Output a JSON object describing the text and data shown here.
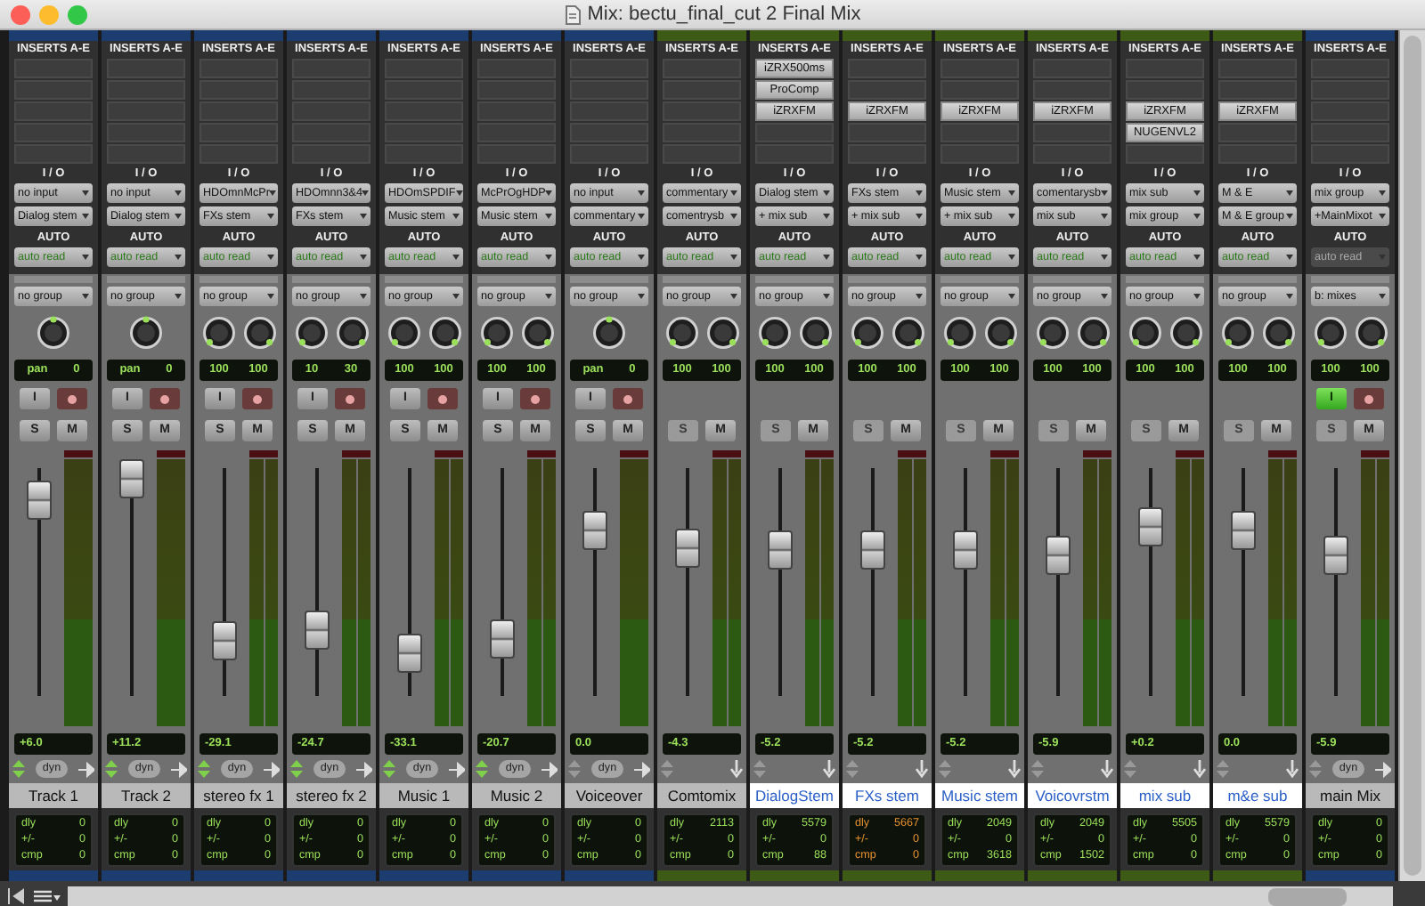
{
  "window": {
    "title": "Mix: bectu_final_cut 2  Final Mix"
  },
  "strips": [
    {
      "name": "Track 1",
      "selected": false,
      "kind": "audio",
      "stereo": false,
      "color": "#1d3d70",
      "inserts": [
        {
          "kind": "empty"
        },
        {
          "kind": "empty"
        },
        {
          "kind": "empty"
        },
        {
          "kind": "empty"
        },
        {
          "kind": "empty"
        }
      ],
      "labels": [
        "INSERTS A-E",
        "I / O",
        "AUTO"
      ],
      "input": "no input",
      "output": "Dialog stem",
      "auto": "auto read",
      "auto_disabled": false,
      "group": "no group",
      "pan": [
        "pan",
        "0"
      ],
      "input_button": {
        "label": "I",
        "on": false
      },
      "solo": {
        "label": "S",
        "disabled": false
      },
      "mute": "M",
      "level": 0.86,
      "volume": "+6.0",
      "arrows_lit": true,
      "dyn": "dyn",
      "delay": [
        {
          "label": "dly",
          "value": "0"
        },
        {
          "label": "+/-",
          "value": "0"
        },
        {
          "label": "cmp",
          "value": "0"
        }
      ],
      "delay_warning": false
    },
    {
      "name": "Track 2",
      "selected": false,
      "kind": "audio",
      "stereo": false,
      "color": "#1d3d70",
      "inserts": [
        {
          "kind": "empty"
        },
        {
          "kind": "empty"
        },
        {
          "kind": "empty"
        },
        {
          "kind": "empty"
        },
        {
          "kind": "empty"
        }
      ],
      "labels": [
        "INSERTS A-E",
        "I / O",
        "AUTO"
      ],
      "input": "no input",
      "output": "Dialog stem",
      "auto": "auto read",
      "auto_disabled": false,
      "group": "no group",
      "pan": [
        "pan",
        "0"
      ],
      "input_button": {
        "label": "I",
        "on": false
      },
      "solo": {
        "label": "S",
        "disabled": false
      },
      "mute": "M",
      "level": 0.95,
      "volume": "+11.2",
      "arrows_lit": true,
      "dyn": "dyn",
      "delay": [
        {
          "label": "dly",
          "value": "0"
        },
        {
          "label": "+/-",
          "value": "0"
        },
        {
          "label": "cmp",
          "value": "0"
        }
      ],
      "delay_warning": false
    },
    {
      "name": "stereo fx 1",
      "selected": false,
      "kind": "audio",
      "stereo": true,
      "color": "#1d3d70",
      "inserts": [
        {
          "kind": "empty"
        },
        {
          "kind": "empty"
        },
        {
          "kind": "empty"
        },
        {
          "kind": "empty"
        },
        {
          "kind": "empty"
        }
      ],
      "labels": [
        "INSERTS A-E",
        "I / O",
        "AUTO"
      ],
      "input": "HDOmnMcPr",
      "output": "FXs stem",
      "auto": "auto read",
      "auto_disabled": false,
      "group": "no group",
      "pan": [
        "100",
        "100"
      ],
      "input_button": {
        "label": "I",
        "on": false
      },
      "solo": {
        "label": "S",
        "disabled": false
      },
      "mute": "M",
      "level": 0.24,
      "volume": "-29.1",
      "arrows_lit": true,
      "dyn": "dyn",
      "delay": [
        {
          "label": "dly",
          "value": "0"
        },
        {
          "label": "+/-",
          "value": "0"
        },
        {
          "label": "cmp",
          "value": "0"
        }
      ],
      "delay_warning": false
    },
    {
      "name": "stereo fx 2",
      "selected": false,
      "kind": "audio",
      "stereo": true,
      "color": "#1d3d70",
      "inserts": [
        {
          "kind": "empty"
        },
        {
          "kind": "empty"
        },
        {
          "kind": "empty"
        },
        {
          "kind": "empty"
        },
        {
          "kind": "empty"
        }
      ],
      "labels": [
        "INSERTS A-E",
        "I / O",
        "AUTO"
      ],
      "input": "HDOmnn3&4",
      "output": "FXs stem",
      "auto": "auto read",
      "auto_disabled": false,
      "group": "no group",
      "pan": [
        "10",
        "30"
      ],
      "input_button": {
        "label": "I",
        "on": false
      },
      "solo": {
        "label": "S",
        "disabled": false
      },
      "mute": "M",
      "level": 0.29,
      "volume": "-24.7",
      "arrows_lit": true,
      "dyn": "dyn",
      "delay": [
        {
          "label": "dly",
          "value": "0"
        },
        {
          "label": "+/-",
          "value": "0"
        },
        {
          "label": "cmp",
          "value": "0"
        }
      ],
      "delay_warning": false
    },
    {
      "name": "Music 1",
      "selected": false,
      "kind": "audio",
      "stereo": true,
      "color": "#1d3d70",
      "inserts": [
        {
          "kind": "empty"
        },
        {
          "kind": "empty"
        },
        {
          "kind": "empty"
        },
        {
          "kind": "empty"
        },
        {
          "kind": "empty"
        }
      ],
      "labels": [
        "INSERTS A-E",
        "I / O",
        "AUTO"
      ],
      "input": "HDOmSPDIF",
      "output": "Music stem",
      "auto": "auto read",
      "auto_disabled": false,
      "group": "no group",
      "pan": [
        "100",
        "100"
      ],
      "input_button": {
        "label": "I",
        "on": false
      },
      "solo": {
        "label": "S",
        "disabled": false
      },
      "mute": "M",
      "level": 0.19,
      "volume": "-33.1",
      "arrows_lit": true,
      "dyn": "dyn",
      "delay": [
        {
          "label": "dly",
          "value": "0"
        },
        {
          "label": "+/-",
          "value": "0"
        },
        {
          "label": "cmp",
          "value": "0"
        }
      ],
      "delay_warning": false
    },
    {
      "name": "Music 2",
      "selected": false,
      "kind": "audio",
      "stereo": true,
      "color": "#1d3d70",
      "inserts": [
        {
          "kind": "empty"
        },
        {
          "kind": "empty"
        },
        {
          "kind": "empty"
        },
        {
          "kind": "empty"
        },
        {
          "kind": "empty"
        }
      ],
      "labels": [
        "INSERTS A-E",
        "I / O",
        "AUTO"
      ],
      "input": "McPrOgHDP",
      "output": "Music stem",
      "auto": "auto read",
      "auto_disabled": false,
      "group": "no group",
      "pan": [
        "100",
        "100"
      ],
      "input_button": {
        "label": "I",
        "on": false
      },
      "solo": {
        "label": "S",
        "disabled": false
      },
      "mute": "M",
      "level": 0.25,
      "volume": "-20.7",
      "arrows_lit": true,
      "dyn": "dyn",
      "delay": [
        {
          "label": "dly",
          "value": "0"
        },
        {
          "label": "+/-",
          "value": "0"
        },
        {
          "label": "cmp",
          "value": "0"
        }
      ],
      "delay_warning": false
    },
    {
      "name": "Voiceover",
      "selected": false,
      "kind": "audio",
      "stereo": false,
      "color": "#1d3d70",
      "inserts": [
        {
          "kind": "empty"
        },
        {
          "kind": "empty"
        },
        {
          "kind": "empty"
        },
        {
          "kind": "empty"
        },
        {
          "kind": "empty"
        }
      ],
      "labels": [
        "INSERTS A-E",
        "I / O",
        "AUTO"
      ],
      "input": "no input",
      "output": "commentary",
      "auto": "auto read",
      "auto_disabled": false,
      "group": "no group",
      "pan": [
        "pan",
        "0"
      ],
      "input_button": {
        "label": "I",
        "on": false
      },
      "solo": {
        "label": "S",
        "disabled": false
      },
      "mute": "M",
      "level": 0.73,
      "volume": "0.0",
      "arrows_lit": false,
      "dyn": "dyn",
      "delay": [
        {
          "label": "dly",
          "value": "0"
        },
        {
          "label": "+/-",
          "value": "0"
        },
        {
          "label": "cmp",
          "value": "0"
        }
      ],
      "delay_warning": false
    },
    {
      "name": "Comtomix",
      "selected": false,
      "kind": "aux",
      "stereo": true,
      "color": "#3d5a16",
      "inserts": [
        {
          "kind": "empty"
        },
        {
          "kind": "empty"
        },
        {
          "kind": "empty"
        },
        {
          "kind": "empty"
        },
        {
          "kind": "empty"
        }
      ],
      "labels": [
        "INSERTS A-E",
        "I / O",
        "AUTO"
      ],
      "input": "commentary",
      "output": "comentrysb",
      "auto": "auto read",
      "auto_disabled": false,
      "group": "no group",
      "pan": [
        "100",
        "100"
      ],
      "solo": {
        "label": "S",
        "disabled": true
      },
      "mute": "M",
      "level": 0.65,
      "volume": "-4.3",
      "arrows_lit": false,
      "delay": [
        {
          "label": "dly",
          "value": "2113"
        },
        {
          "label": "+/-",
          "value": "0"
        },
        {
          "label": "cmp",
          "value": "0"
        }
      ],
      "delay_warning": false
    },
    {
      "name": "DialogStem",
      "selected": true,
      "kind": "aux",
      "stereo": true,
      "color": "#3d5a16",
      "inserts": [
        {
          "kind": "plugin",
          "name": "iZRX500ms"
        },
        {
          "kind": "plugin",
          "name": "ProComp"
        },
        {
          "kind": "plugin",
          "name": "iZRXFM"
        },
        {
          "kind": "empty"
        },
        {
          "kind": "empty"
        }
      ],
      "labels": [
        "INSERTS A-E",
        "I / O",
        "AUTO"
      ],
      "input": "Dialog stem",
      "output": "+ mix sub",
      "auto": "auto read",
      "auto_disabled": false,
      "group": "no group",
      "pan": [
        "100",
        "100"
      ],
      "solo": {
        "label": "S",
        "disabled": true
      },
      "mute": "M",
      "level": 0.64,
      "volume": "-5.2",
      "arrows_lit": false,
      "delay": [
        {
          "label": "dly",
          "value": "5579"
        },
        {
          "label": "+/-",
          "value": "0"
        },
        {
          "label": "cmp",
          "value": "88"
        }
      ],
      "delay_warning": false
    },
    {
      "name": "FXs stem",
      "selected": true,
      "kind": "aux",
      "stereo": true,
      "color": "#3d5a16",
      "inserts": [
        {
          "kind": "empty"
        },
        {
          "kind": "empty"
        },
        {
          "kind": "plugin",
          "name": "iZRXFM"
        },
        {
          "kind": "empty"
        },
        {
          "kind": "empty"
        }
      ],
      "labels": [
        "INSERTS A-E",
        "I / O",
        "AUTO"
      ],
      "input": "FXs stem",
      "output": "+ mix sub",
      "auto": "auto read",
      "auto_disabled": false,
      "group": "no group",
      "pan": [
        "100",
        "100"
      ],
      "solo": {
        "label": "S",
        "disabled": true
      },
      "mute": "M",
      "level": 0.64,
      "volume": "-5.2",
      "arrows_lit": false,
      "delay": [
        {
          "label": "dly",
          "value": "5667"
        },
        {
          "label": "+/-",
          "value": "0"
        },
        {
          "label": "cmp",
          "value": "0"
        }
      ],
      "delay_warning": true
    },
    {
      "name": "Music stem",
      "selected": true,
      "kind": "aux",
      "stereo": true,
      "color": "#3d5a16",
      "inserts": [
        {
          "kind": "empty"
        },
        {
          "kind": "empty"
        },
        {
          "kind": "plugin",
          "name": "iZRXFM"
        },
        {
          "kind": "empty"
        },
        {
          "kind": "empty"
        }
      ],
      "labels": [
        "INSERTS A-E",
        "I / O",
        "AUTO"
      ],
      "input": "Music stem",
      "output": "+ mix sub",
      "auto": "auto read",
      "auto_disabled": false,
      "group": "no group",
      "pan": [
        "100",
        "100"
      ],
      "solo": {
        "label": "S",
        "disabled": true
      },
      "mute": "M",
      "level": 0.64,
      "volume": "-5.2",
      "arrows_lit": false,
      "delay": [
        {
          "label": "dly",
          "value": "2049"
        },
        {
          "label": "+/-",
          "value": "0"
        },
        {
          "label": "cmp",
          "value": "3618"
        }
      ],
      "delay_warning": false
    },
    {
      "name": "Voicovrstm",
      "selected": true,
      "kind": "aux",
      "stereo": true,
      "color": "#3d5a16",
      "inserts": [
        {
          "kind": "empty"
        },
        {
          "kind": "empty"
        },
        {
          "kind": "plugin",
          "name": "iZRXFM"
        },
        {
          "kind": "empty"
        },
        {
          "kind": "empty"
        }
      ],
      "labels": [
        "INSERTS A-E",
        "I / O",
        "AUTO"
      ],
      "input": "comentarysb",
      "output": "mix sub",
      "auto": "auto read",
      "auto_disabled": false,
      "group": "no group",
      "pan": [
        "100",
        "100"
      ],
      "solo": {
        "label": "S",
        "disabled": true
      },
      "mute": "M",
      "level": 0.62,
      "volume": "-5.9",
      "arrows_lit": false,
      "delay": [
        {
          "label": "dly",
          "value": "2049"
        },
        {
          "label": "+/-",
          "value": "0"
        },
        {
          "label": "cmp",
          "value": "1502"
        }
      ],
      "delay_warning": false
    },
    {
      "name": "mix sub",
      "selected": true,
      "kind": "aux",
      "stereo": true,
      "color": "#3d5a16",
      "inserts": [
        {
          "kind": "empty"
        },
        {
          "kind": "empty"
        },
        {
          "kind": "plugin",
          "name": "iZRXFM"
        },
        {
          "kind": "plugin",
          "name": "NUGENVL2"
        },
        {
          "kind": "empty"
        }
      ],
      "labels": [
        "INSERTS A-E",
        "I / O",
        "AUTO"
      ],
      "input": "mix sub",
      "output": "mix group",
      "auto": "auto read",
      "auto_disabled": false,
      "group": "no group",
      "pan": [
        "100",
        "100"
      ],
      "solo": {
        "label": "S",
        "disabled": true
      },
      "mute": "M",
      "level": 0.74,
      "volume": "+0.2",
      "arrows_lit": false,
      "delay": [
        {
          "label": "dly",
          "value": "5505"
        },
        {
          "label": "+/-",
          "value": "0"
        },
        {
          "label": "cmp",
          "value": "0"
        }
      ],
      "delay_warning": false
    },
    {
      "name": "m&e sub",
      "selected": true,
      "kind": "aux",
      "stereo": true,
      "color": "#3d5a16",
      "inserts": [
        {
          "kind": "empty"
        },
        {
          "kind": "empty"
        },
        {
          "kind": "plugin",
          "name": "iZRXFM"
        },
        {
          "kind": "empty"
        },
        {
          "kind": "empty"
        }
      ],
      "labels": [
        "INSERTS A-E",
        "I / O",
        "AUTO"
      ],
      "input": "M & E",
      "output": "M & E group",
      "auto": "auto read",
      "auto_disabled": false,
      "group": "no group",
      "pan": [
        "100",
        "100"
      ],
      "solo": {
        "label": "S",
        "disabled": true
      },
      "mute": "M",
      "level": 0.73,
      "volume": "0.0",
      "arrows_lit": false,
      "delay": [
        {
          "label": "dly",
          "value": "5579"
        },
        {
          "label": "+/-",
          "value": "0"
        },
        {
          "label": "cmp",
          "value": "0"
        }
      ],
      "delay_warning": false
    },
    {
      "name": "main Mix",
      "selected": false,
      "kind": "master",
      "stereo": true,
      "color": "#1d3d70",
      "inserts": [
        {
          "kind": "empty"
        },
        {
          "kind": "empty"
        },
        {
          "kind": "empty"
        },
        {
          "kind": "empty"
        },
        {
          "kind": "empty"
        }
      ],
      "labels": [
        "INSERTS A-E",
        "I / O",
        "AUTO"
      ],
      "input": "mix group",
      "output": "+MainMixot",
      "auto": "auto read",
      "auto_disabled": true,
      "group": "b: mixes",
      "pan": [
        "100",
        "100"
      ],
      "input_button": {
        "label": "I",
        "on": true
      },
      "solo": {
        "label": "S",
        "disabled": true
      },
      "mute": "M",
      "level": 0.62,
      "volume": "-5.9",
      "arrows_lit": false,
      "dyn": "dyn",
      "delay": [
        {
          "label": "dly",
          "value": "0"
        },
        {
          "label": "+/-",
          "value": "0"
        },
        {
          "label": "cmp",
          "value": "0"
        }
      ],
      "delay_warning": false
    }
  ]
}
